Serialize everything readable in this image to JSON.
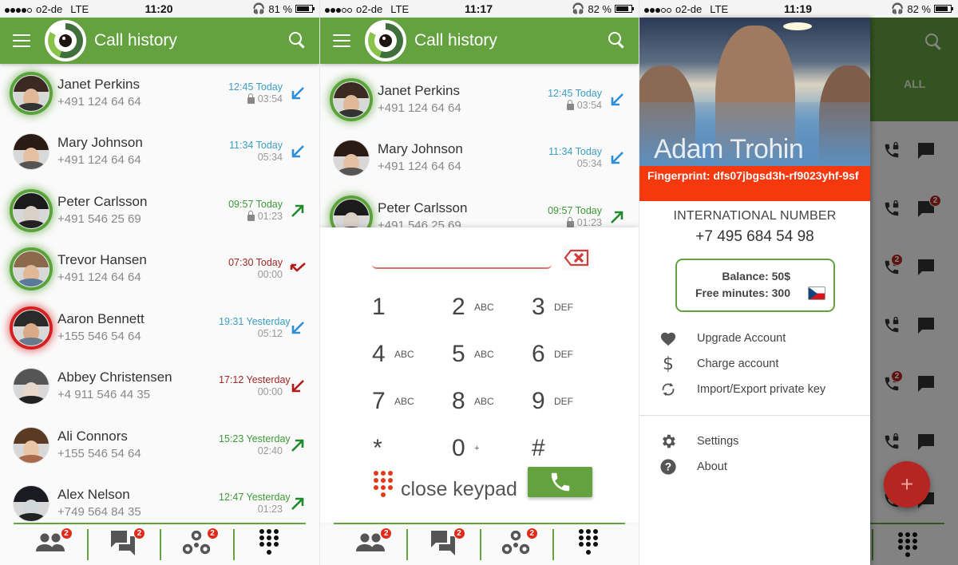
{
  "screens": [
    {
      "status": {
        "carrier": "o2-de",
        "network": "LTE",
        "time": "11:20",
        "battery": "81 %",
        "signal_bars": 4,
        "signal_max": 5
      },
      "appbar": {
        "title": "Call history"
      },
      "calls": [
        {
          "name": "Janet Perkins",
          "number": "+491 124 64 64",
          "time": "12:45 Today",
          "duration": "03:54",
          "locked": true,
          "direction": "incoming",
          "status_glow": "green"
        },
        {
          "name": "Mary Johnson",
          "number": "+491 124 64 64",
          "time": "11:34 Today",
          "duration": "05:34",
          "locked": false,
          "direction": "incoming",
          "status_glow": "none"
        },
        {
          "name": "Peter Carlsson",
          "number": "+491 546 25 69",
          "time": "09:57 Today",
          "duration": "01:23",
          "locked": true,
          "direction": "outgoing",
          "status_glow": "green"
        },
        {
          "name": "Trevor Hansen",
          "number": "+491 124 64 64",
          "time": "07:30 Today",
          "duration": "00:00",
          "locked": false,
          "direction": "missed",
          "status_glow": "green"
        },
        {
          "name": "Aaron Bennett",
          "number": "+155 546 54 64",
          "time": "19:31 Yesterday",
          "duration": "05:12",
          "locked": false,
          "direction": "incoming",
          "status_glow": "red"
        },
        {
          "name": "Abbey Christensen",
          "number": "+4 911 546 44 35",
          "time": "17:12 Yesterday",
          "duration": "00:00",
          "locked": false,
          "direction": "rejected",
          "status_glow": "none"
        },
        {
          "name": "Ali Connors",
          "number": "+155 546 54 64",
          "time": "15:23 Yesterday",
          "duration": "02:40",
          "locked": false,
          "direction": "outgoing",
          "status_glow": "none"
        },
        {
          "name": "Alex Nelson",
          "number": "+749 564 84 35",
          "time": "12:47 Yesterday",
          "duration": "01:23",
          "locked": false,
          "direction": "outgoing",
          "status_glow": "none"
        }
      ],
      "bottom_nav": [
        {
          "icon": "contacts-icon",
          "badge": "2"
        },
        {
          "icon": "chat-icon",
          "badge": "2"
        },
        {
          "icon": "groups-icon",
          "badge": "2"
        },
        {
          "icon": "dialpad-icon",
          "badge": ""
        }
      ]
    },
    {
      "status": {
        "carrier": "o2-de",
        "network": "LTE",
        "time": "11:17",
        "battery": "82 %",
        "signal_bars": 3,
        "signal_max": 5
      },
      "appbar": {
        "title": "Call history"
      },
      "calls": [
        {
          "name": "Janet Perkins",
          "number": "+491 124 64 64",
          "time": "12:45 Today",
          "duration": "03:54",
          "locked": true,
          "direction": "incoming",
          "status_glow": "green"
        },
        {
          "name": "Mary Johnson",
          "number": "+491 124 64 64",
          "time": "11:34 Today",
          "duration": "05:34",
          "locked": false,
          "direction": "incoming",
          "status_glow": "none"
        },
        {
          "name": "Peter Carlsson",
          "number": "+491 546 25 69",
          "time": "09:57 Today",
          "duration": "01:23",
          "locked": true,
          "direction": "outgoing",
          "status_glow": "green"
        }
      ],
      "keypad": {
        "input_value": "",
        "keys": [
          [
            {
              "digit": "1",
              "sub": ""
            },
            {
              "digit": "2",
              "sub": "ABC"
            },
            {
              "digit": "3",
              "sub": "DEF"
            }
          ],
          [
            {
              "digit": "4",
              "sub": "ABC"
            },
            {
              "digit": "5",
              "sub": "ABC"
            },
            {
              "digit": "6",
              "sub": "DEF"
            }
          ],
          [
            {
              "digit": "7",
              "sub": "ABC"
            },
            {
              "digit": "8",
              "sub": "ABC"
            },
            {
              "digit": "9",
              "sub": "DEF"
            }
          ],
          [
            {
              "digit": "*",
              "sub": ""
            },
            {
              "digit": "0",
              "sub": "+"
            },
            {
              "digit": "#",
              "sub": ""
            }
          ]
        ],
        "close_label": "close keypad"
      },
      "bottom_nav": [
        {
          "icon": "contacts-icon",
          "badge": "2"
        },
        {
          "icon": "chat-icon",
          "badge": "2"
        },
        {
          "icon": "groups-icon",
          "badge": "2"
        },
        {
          "icon": "dialpad-icon",
          "badge": ""
        }
      ]
    },
    {
      "status": {
        "carrier": "o2-de",
        "network": "LTE",
        "time": "11:19",
        "battery": "82 %",
        "signal_bars": 3,
        "signal_max": 5
      },
      "background": {
        "tab_label": "ALL",
        "rows": [
          {
            "call_badge": "",
            "chat_badge": ""
          },
          {
            "call_badge": "",
            "chat_badge": "2"
          },
          {
            "call_badge": "2",
            "chat_badge": ""
          },
          {
            "call_badge": "",
            "chat_badge": ""
          },
          {
            "call_badge": "2",
            "chat_badge": ""
          },
          {
            "call_badge": "",
            "chat_badge": ""
          },
          {
            "call_badge": "",
            "chat_badge": ""
          }
        ],
        "fab_label": "+"
      },
      "drawer": {
        "user_name": "Adam Trohin",
        "fingerprint": "Fingerprint: dfs07jbgsd3h-rf9023yhf-9sf",
        "number_label": "INTERNATIONAL NUMBER",
        "number": "+7 495 684 54 98",
        "balance": "Balance: 50$",
        "free_minutes": "Free minutes: 300",
        "flag": "czech-flag",
        "menu": [
          {
            "icon": "heart-icon",
            "label": "Upgrade Account"
          },
          {
            "icon": "dollar-icon",
            "label": "Charge account"
          },
          {
            "icon": "sync-icon",
            "label": "Import/Export private key"
          }
        ],
        "menu_secondary": [
          {
            "icon": "gear-icon",
            "label": "Settings"
          },
          {
            "icon": "help-icon",
            "label": "About"
          }
        ]
      }
    }
  ],
  "colors": {
    "primary": "#63a23f",
    "incoming": "#2e8fd6",
    "outgoing": "#1f8a2a",
    "missed": "#b01c1c",
    "time_incoming": "#3d9ec4",
    "time_outgoing": "#3c9a36",
    "time_missed": "#a02828",
    "badge": "#e02a1a",
    "fingerprint_bg": "#f5380d",
    "fab": "#b52521"
  }
}
